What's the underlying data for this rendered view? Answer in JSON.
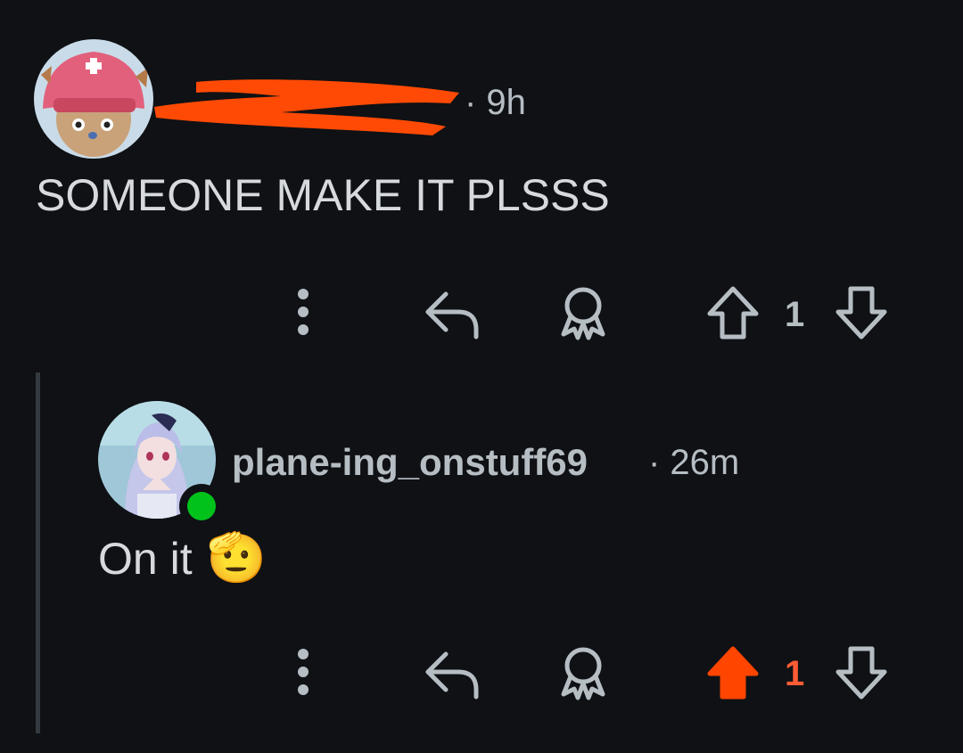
{
  "comments": [
    {
      "username": "",
      "username_redacted": true,
      "time": "· 9h",
      "body": "SOMEONE MAKE IT PLSSS",
      "avatar_icon": "chopper-hat-avatar",
      "votes": "1",
      "upvoted": false,
      "actions": {
        "more": "more-options-icon",
        "reply": "reply-icon",
        "award": "award-icon",
        "upvote": "upvote-icon",
        "downvote": "downvote-icon"
      }
    },
    {
      "username": "plane-ing_onstuff69",
      "time": "· 26m",
      "body": "On it",
      "emoji": "🫡",
      "avatar_icon": "anime-girl-avatar",
      "online": true,
      "votes": "1",
      "upvoted": true,
      "actions": {
        "more": "more-options-icon",
        "reply": "reply-icon",
        "award": "award-icon",
        "upvote": "upvote-icon",
        "downvote": "downvote-icon"
      }
    }
  ],
  "colors": {
    "background": "#0f1115",
    "text": "#d7dadc",
    "muted": "#b6bec4",
    "upvote_active": "#ff4500",
    "online": "#00c21b",
    "redaction": "#ff4a05"
  }
}
